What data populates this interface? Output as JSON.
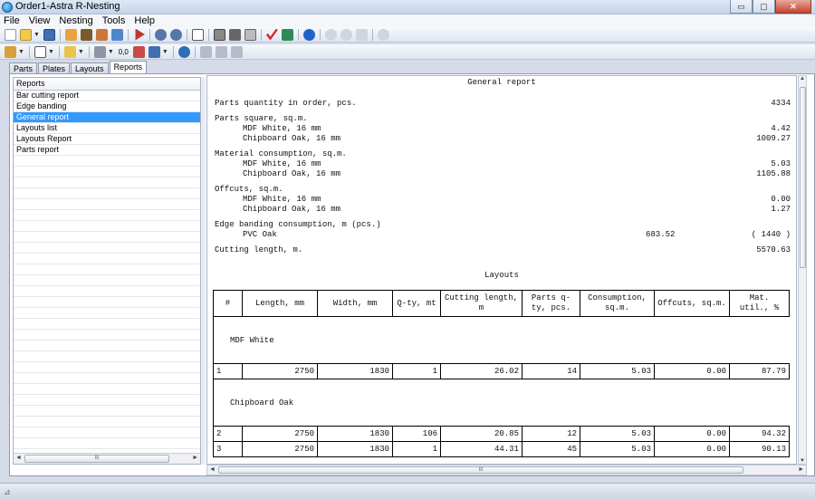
{
  "window": {
    "title": "Order1-Astra R-Nesting",
    "min": "▭",
    "max": "▢",
    "close": "✕"
  },
  "menu": [
    "File",
    "View",
    "Nesting",
    "Tools",
    "Help"
  ],
  "toolbar2_text": {
    "zero_zero": "0,0"
  },
  "tabs": [
    {
      "label": "Parts"
    },
    {
      "label": "Plates"
    },
    {
      "label": "Layouts"
    },
    {
      "label": "Reports"
    }
  ],
  "reports_panel": {
    "header": "Reports",
    "items": [
      "Bar cutting report",
      "Edge banding",
      "General report",
      "Layouts list",
      "Layouts Report",
      "Parts report"
    ],
    "selected": "General report"
  },
  "report": {
    "title": "General report",
    "parts_qty_label": "Parts quantity in order, pcs.",
    "parts_qty_value": "4334",
    "parts_square_label": "Parts square, sq.m.",
    "parts_square": [
      {
        "material": "MDF White, 16 mm",
        "value": "4.42"
      },
      {
        "material": "Chipboard Oak, 16 mm",
        "value": "1009.27"
      }
    ],
    "material_consumption_label": "Material consumption, sq.m.",
    "material_consumption": [
      {
        "material": "MDF White, 16 mm",
        "value": "5.03"
      },
      {
        "material": "Chipboard Oak, 16 mm",
        "value": "1105.88"
      }
    ],
    "offcuts_label": "Offcuts, sq.m.",
    "offcuts": [
      {
        "material": "MDF White, 16 mm",
        "value": "0.00"
      },
      {
        "material": "Chipboard Oak, 16 mm",
        "value": "1.27"
      }
    ],
    "edge_label": "Edge banding consumption, m (pcs.)",
    "edge_material": "PVC Oak",
    "edge_length": "683.52",
    "edge_pcs": "( 1440 )",
    "cutting_length_label": "Cutting length, m.",
    "cutting_length_value": "5570.63",
    "layouts_title": "Layouts",
    "columns": [
      "#",
      "Length, mm",
      "Width, mm",
      "Q-ty, mt",
      "Cutting length, m",
      "Parts q-ty, pcs.",
      "Consumption, sq.m.",
      "Offcuts, sq.m.",
      "Mat. util., %"
    ],
    "groups": [
      {
        "name": "MDF White",
        "rows": [
          [
            "1",
            "2750",
            "1830",
            "1",
            "26.02",
            "14",
            "5.03",
            "0.00",
            "87.79"
          ]
        ]
      },
      {
        "name": "Chipboard Oak",
        "rows": [
          [
            "2",
            "2750",
            "1830",
            "106",
            "20.85",
            "12",
            "5.03",
            "0.00",
            "94.32"
          ],
          [
            "3",
            "2750",
            "1830",
            "1",
            "44.31",
            "45",
            "5.03",
            "0.00",
            "90.13"
          ]
        ]
      }
    ]
  },
  "scroll": {
    "up": "▲",
    "down": "▼",
    "left": "◄",
    "right": "►",
    "grip": "III"
  },
  "statusbar": {
    "grip": "⊿"
  }
}
